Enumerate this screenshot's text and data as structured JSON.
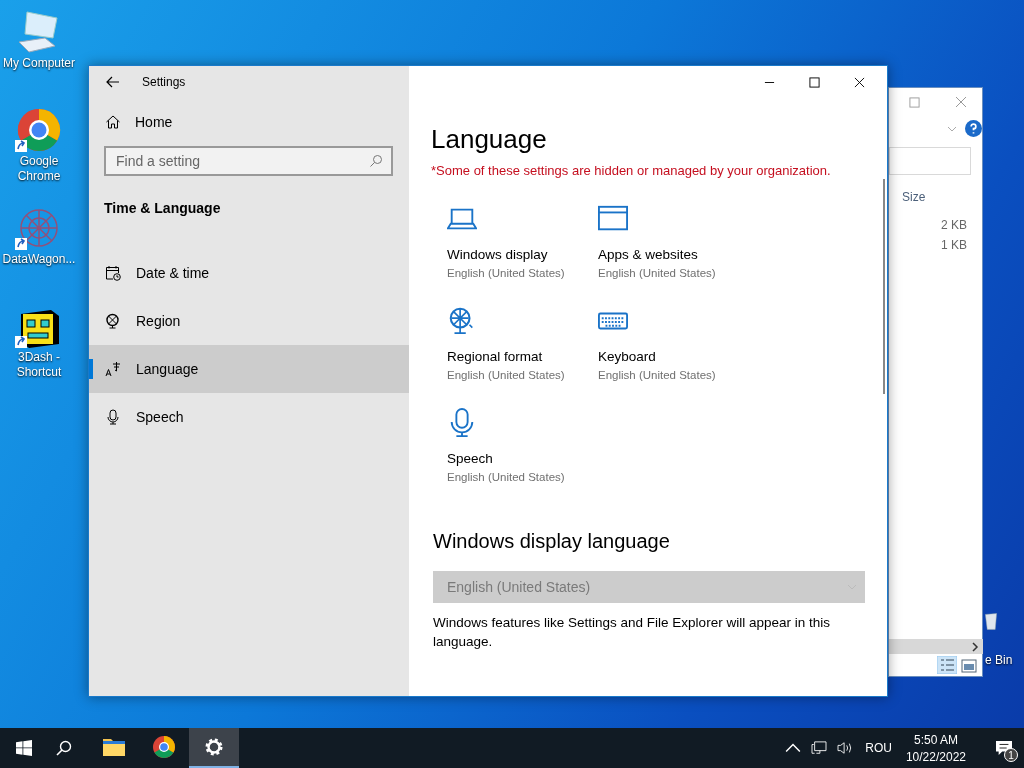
{
  "desktop_icons": [
    {
      "label": "My Computer",
      "kind": "computer",
      "shortcut": false
    },
    {
      "label": "Google Chrome",
      "kind": "chrome",
      "shortcut": true
    },
    {
      "label": "DataWagon...",
      "kind": "datawagon",
      "shortcut": true
    },
    {
      "label": "3Dash - Shortcut",
      "kind": "dash",
      "shortcut": true
    }
  ],
  "recycle_bin": {
    "label": "e Bin"
  },
  "explorer_window": {
    "column_header": "Size",
    "sizes": [
      "2 KB",
      "1 KB"
    ]
  },
  "settings": {
    "title": "Settings",
    "home": "Home",
    "search": {
      "placeholder": "Find a setting"
    },
    "section": "Time & Language",
    "nav": [
      {
        "label": "Date & time",
        "kind": "calendar",
        "selected": false
      },
      {
        "label": "Region",
        "kind": "globe",
        "selected": false
      },
      {
        "label": "Language",
        "kind": "language",
        "selected": true
      },
      {
        "label": "Speech",
        "kind": "mic",
        "selected": false
      }
    ],
    "page_title": "Language",
    "warning": "*Some of these settings are hidden or managed by your organization.",
    "tiles": [
      {
        "title": "Windows display",
        "value": "English (United States)",
        "kind": "laptop"
      },
      {
        "title": "Apps & websites",
        "value": "English (United States)",
        "kind": "window"
      },
      {
        "title": "Regional format",
        "value": "English (United States)",
        "kind": "globe"
      },
      {
        "title": "Keyboard",
        "value": "English (United States)",
        "kind": "keyboard"
      },
      {
        "title": "Speech",
        "value": "English (United States)",
        "kind": "mic"
      }
    ],
    "display_language": {
      "heading": "Windows display language",
      "dropdown": {
        "value": "English (United States)",
        "disabled": true
      },
      "description": "Windows features like Settings and File Explorer will appear in this language."
    }
  },
  "taskbar": {
    "apps": [
      {
        "kind": "explorer",
        "selected": false
      },
      {
        "kind": "chrome",
        "selected": false
      },
      {
        "kind": "settings",
        "selected": true
      }
    ],
    "language": "ROU",
    "time": "5:50 AM",
    "date": "10/22/2022",
    "notifications": "1"
  }
}
